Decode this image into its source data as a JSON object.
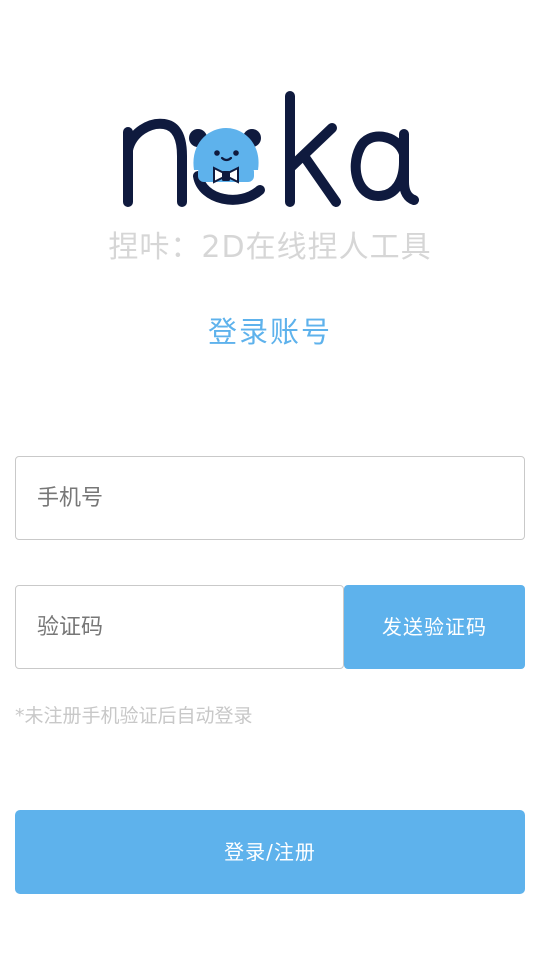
{
  "brand": {
    "logo_text": "noka",
    "slogan": "捏咔：2D在线捏人工具",
    "colors": {
      "logo_dark": "#0f1a3e",
      "panda_blue": "#5eb2ec"
    }
  },
  "login": {
    "title": "登录账号",
    "phone": {
      "placeholder": "手机号",
      "value": ""
    },
    "code": {
      "placeholder": "验证码",
      "value": ""
    },
    "send_code_label": "发送验证码",
    "hint": "*未注册手机验证后自动登录",
    "submit_label": "登录/注册"
  },
  "theme": {
    "accent": "#5eb2ec",
    "hint_text": "#c8c8c8",
    "border": "#c9c9c9"
  }
}
